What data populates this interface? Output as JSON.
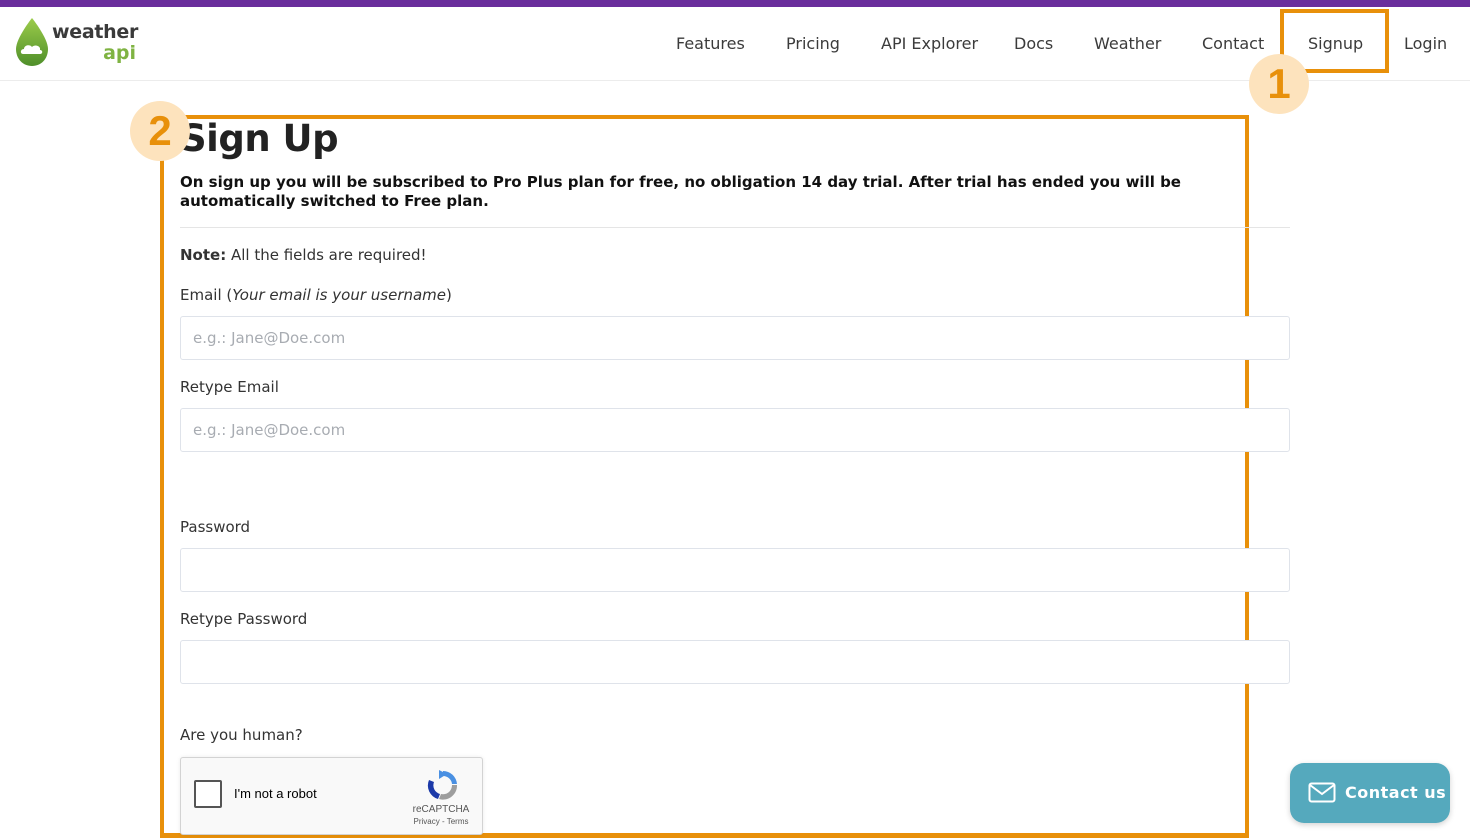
{
  "brand": {
    "name_line1": "weather",
    "name_line2": "api",
    "colors": {
      "stripe": "#6a2e9c",
      "logo_green": "#7fb342",
      "annotation": "#e8900a",
      "contact": "#55a9bd"
    }
  },
  "nav": {
    "items": [
      {
        "label": "Features"
      },
      {
        "label": "Pricing"
      },
      {
        "label": "API Explorer"
      },
      {
        "label": "Docs"
      },
      {
        "label": "Weather"
      },
      {
        "label": "Contact"
      },
      {
        "label": "Signup"
      },
      {
        "label": "Login"
      }
    ]
  },
  "annotations": {
    "step1": "1",
    "step2": "2"
  },
  "signup": {
    "title": "Sign Up",
    "intro": "On sign up you will be subscribed to Pro Plus plan for free, no obligation 14 day trial. After trial has ended you will be automatically switched to Free plan.",
    "note_label": "Note:",
    "note_text": " All the fields are required!",
    "email_label": "Email (",
    "email_hint": "Your email is your username",
    "email_label_end": ")",
    "email_placeholder": "e.g.: Jane@Doe.com",
    "retype_email_label": "Retype Email",
    "retype_email_placeholder": "e.g.: Jane@Doe.com",
    "password_label": "Password",
    "retype_password_label": "Retype Password",
    "human_label": "Are you human?"
  },
  "captcha": {
    "label": "I'm not a robot",
    "brand": "reCAPTCHA",
    "links": "Privacy - Terms",
    "icon": "recaptcha-icon"
  },
  "contact_widget": {
    "label": "Contact us",
    "icon": "envelope-icon"
  }
}
